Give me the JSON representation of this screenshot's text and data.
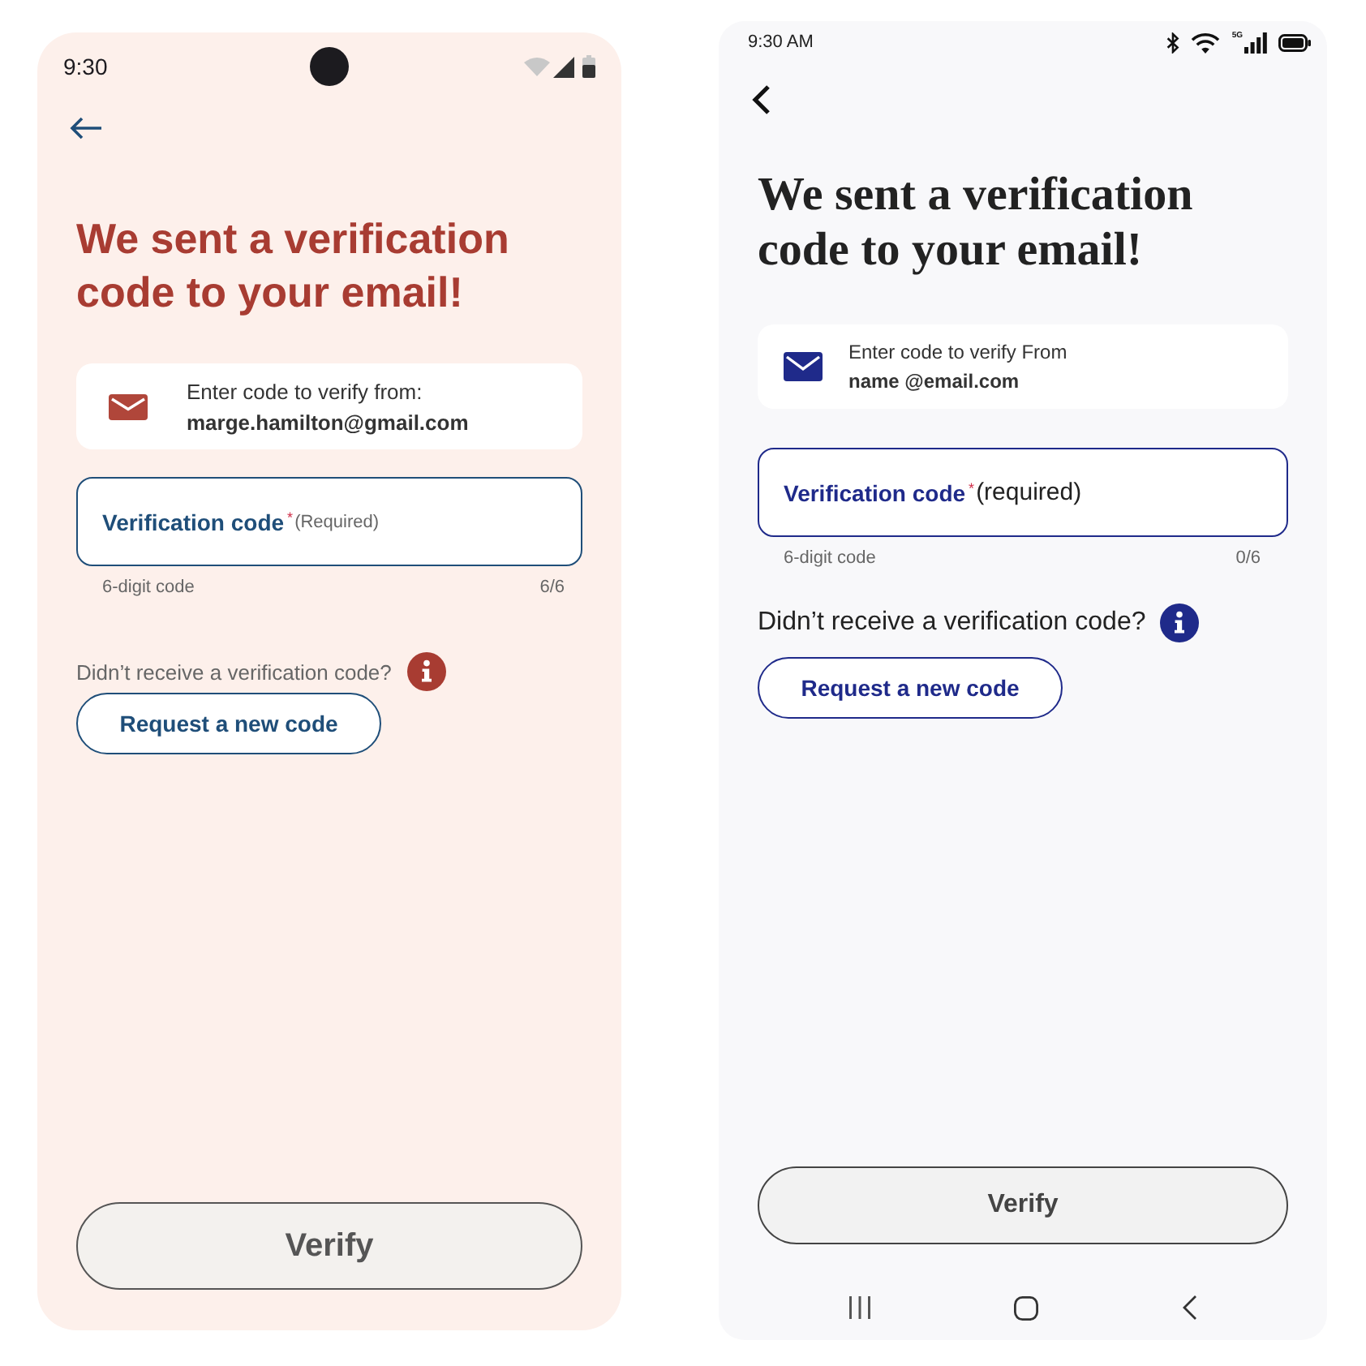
{
  "phones": [
    {
      "kind": "android",
      "status_bar": {
        "time": "9:30"
      },
      "title": "We sent a verification code to your email!",
      "info_card": {
        "instruction": "Enter code to verify from:",
        "email": "marge.hamilton@gmail.com"
      },
      "code_field": {
        "label": "Verification code",
        "required_mark": "*",
        "required_note": "(Required)",
        "helper": "6-digit code",
        "counter": "6/6"
      },
      "resend_prompt": "Didn’t receive a verification code?",
      "request_button": "Request a new code",
      "verify_button": {
        "label": "Verify",
        "disabled": true
      }
    },
    {
      "kind": "samsung",
      "status_bar": {
        "time": "9:30 AM",
        "network": "5G"
      },
      "title": "We sent a verification code to your email!",
      "info_card": {
        "instruction": "Enter code to verify From",
        "email": "name @email.com"
      },
      "code_field": {
        "label": "Verification code",
        "required_mark": "*",
        "required_note": "(required)",
        "helper": "6-digit code",
        "counter": "0/6"
      },
      "resend_prompt": "Didn’t receive a verification code?",
      "request_button": "Request a new code",
      "verify_button": {
        "label": "Verify",
        "disabled": true
      }
    }
  ]
}
